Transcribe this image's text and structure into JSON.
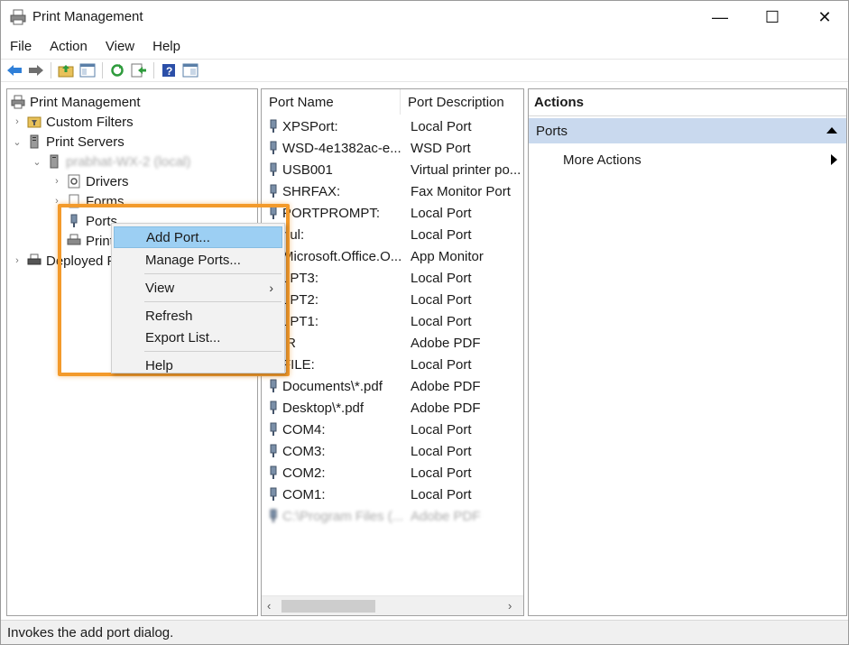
{
  "window": {
    "title": "Print Management",
    "controls": {
      "minimize": "—",
      "maximize": "☐",
      "close": "✕"
    }
  },
  "menubar": [
    "File",
    "Action",
    "View",
    "Help"
  ],
  "toolbar": {
    "icons": [
      "back-arrow-icon",
      "forward-arrow-icon",
      "up-folder-icon",
      "show-hide-tree-icon",
      "refresh-icon",
      "export-list-icon",
      "help-icon",
      "properties-icon"
    ]
  },
  "tree": {
    "root": "Print Management",
    "custom_filters": "Custom Filters",
    "print_servers": "Print Servers",
    "server_name": "prabhat-WX-2 (local)",
    "drivers": "Drivers",
    "forms": "Forms",
    "ports": "Ports",
    "printers": "Printers",
    "deployed": "Deployed Printers"
  },
  "list": {
    "columns": {
      "name": "Port Name",
      "description": "Port Description"
    },
    "rows": [
      {
        "name": "XPSPort:",
        "description": "Local Port"
      },
      {
        "name": "WSD-4e1382ac-e...",
        "description": "WSD Port"
      },
      {
        "name": "USB001",
        "description": "Virtual printer po..."
      },
      {
        "name": "SHRFAX:",
        "description": "Fax Monitor Port"
      },
      {
        "name": "PORTPROMPT:",
        "description": "Local Port"
      },
      {
        "name": "nul:",
        "description": "Local Port"
      },
      {
        "name": "Microsoft.Office.O...",
        "description": "App Monitor"
      },
      {
        "name": "LPT3:",
        "description": "Local Port"
      },
      {
        "name": "LPT2:",
        "description": "Local Port"
      },
      {
        "name": "LPT1:",
        "description": "Local Port"
      },
      {
        "name": "IR",
        "description": "Adobe PDF"
      },
      {
        "name": "FILE:",
        "description": "Local Port"
      },
      {
        "name": "Documents\\*.pdf",
        "description": "Adobe PDF"
      },
      {
        "name": "Desktop\\*.pdf",
        "description": "Adobe PDF"
      },
      {
        "name": "COM4:",
        "description": "Local Port"
      },
      {
        "name": "COM3:",
        "description": "Local Port"
      },
      {
        "name": "COM2:",
        "description": "Local Port"
      },
      {
        "name": "COM1:",
        "description": "Local Port"
      },
      {
        "name": "C:\\Program Files (...",
        "description": "Adobe PDF"
      }
    ]
  },
  "actions": {
    "title": "Actions",
    "section": "Ports",
    "more_actions": "More Actions"
  },
  "context_menu": {
    "add_port": "Add Port...",
    "manage_ports": "Manage Ports...",
    "view": "View",
    "refresh": "Refresh",
    "export_list": "Export List...",
    "help": "Help"
  },
  "status": "Invokes the add port dialog.",
  "colors": {
    "highlight_border": "#f39a2b",
    "menu_hover": "#9ccff3",
    "actions_section": "#c9d9ee"
  }
}
